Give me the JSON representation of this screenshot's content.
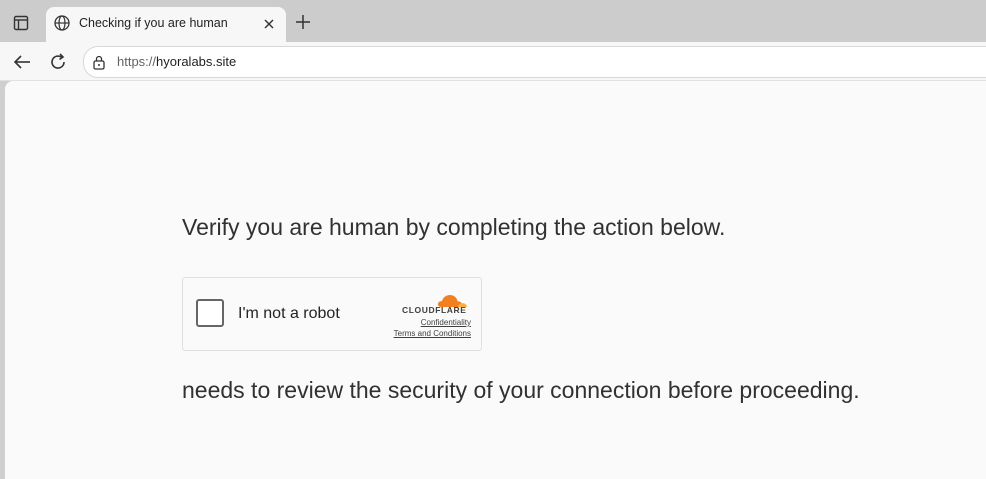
{
  "browser": {
    "tab": {
      "title": "Checking if you are human",
      "favicon": "globe-icon"
    },
    "address_bar": {
      "scheme": "https://",
      "host": "hyoralabs.site"
    },
    "icons": {
      "tab_actions": "tab-actions-icon",
      "close": "close-icon",
      "new_tab": "plus-icon",
      "back": "back-arrow-icon",
      "reload": "reload-icon",
      "site_info": "lock-icon"
    }
  },
  "page": {
    "heading": "Verify you are human by completing the action below.",
    "challenge": {
      "checkbox_label": "I'm not a robot",
      "checked": false,
      "brand": "CLOUDFLARE",
      "privacy_link": "Confidentiality",
      "terms_link": "Terms and Conditions",
      "brand_color": "#f38020"
    },
    "subtext": "needs to review the security of your connection before proceeding."
  }
}
